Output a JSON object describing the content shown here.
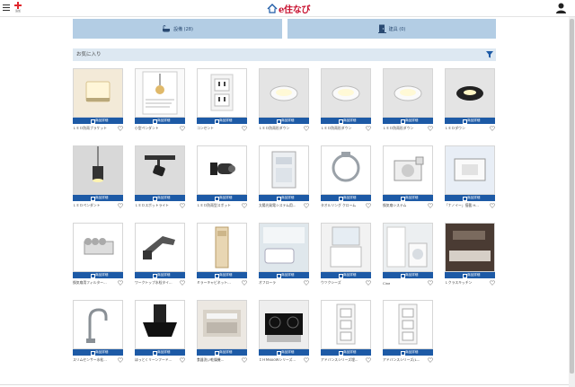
{
  "header": {
    "menu_icon": "hamburger-icon",
    "plus_label": "追加",
    "logo_text": "e住なび",
    "logo_icon": "house-icon",
    "user_icon": "user-icon"
  },
  "tabs": [
    {
      "label": "設備 (28)",
      "icon": "bath-icon"
    },
    {
      "label": "建具 (0)",
      "icon": "door-icon"
    }
  ],
  "favorites": {
    "title": "お気に入り",
    "filter_icon": "filter-icon"
  },
  "badge_label": "商品詳細",
  "colors": {
    "accent": "#1d5aa6",
    "tab_bg": "#b3cde4",
    "bar_bg": "#dde8f2",
    "brand": "#c8102e"
  },
  "products": [
    {
      "name": "ＬＥＤ防雨ブラケット",
      "image": "wall-bracket-light"
    },
    {
      "name": "小型ペンダント",
      "image": "pendant-catalog"
    },
    {
      "name": "コンセント",
      "image": "wall-outlet"
    },
    {
      "name": "ＬＥＤ防雨形ダウン",
      "image": "downlight"
    },
    {
      "name": "ＬＥＤ防雨形ダウン",
      "image": "downlight"
    },
    {
      "name": "ＬＥＤ防雨形ダウン",
      "image": "downlight"
    },
    {
      "name": "ＬＥＤダウン",
      "image": "downlight-black"
    },
    {
      "name": "ＬＥＤペンダント",
      "image": "pendant-light"
    },
    {
      "name": "ＬＥＤスポットライト",
      "image": "spotlight"
    },
    {
      "name": "ＬＥＤ防雨型スポット",
      "image": "outdoor-spot"
    },
    {
      "name": "太陽光発電システム用...",
      "image": "power-conditioner"
    },
    {
      "name": "タオルリング クローム",
      "image": "towel-ring"
    },
    {
      "name": "換気扇システム",
      "image": "ventilation-fan"
    },
    {
      "name": "「ナノイー」搭載 H...",
      "image": "ceiling-ac"
    },
    {
      "name": "換気扇用フィルター...",
      "image": "vent-filter"
    },
    {
      "name": "ワークトップ水栓タイ...",
      "image": "kitchen-faucet"
    },
    {
      "name": "ミラーキャビネット...",
      "image": "tall-cabinet"
    },
    {
      "name": "オフローラ",
      "image": "bathroom"
    },
    {
      "name": "ウツクシーズ",
      "image": "vanity"
    },
    {
      "name": "Cine",
      "image": "laundry-room"
    },
    {
      "name": "Ｌクラスキッチン",
      "image": "kitchen"
    },
    {
      "name": "スリムセンサー水栓...",
      "image": "sensor-faucet"
    },
    {
      "name": "ほっとくリーンフード...",
      "image": "range-hood"
    },
    {
      "name": "食器洗い乾燥機...",
      "image": "dishwasher"
    },
    {
      "name": "ＩＨＭ600Ｗシリーズ...",
      "image": "ih-cooktop"
    },
    {
      "name": "アドバンスシリーズ埋...",
      "image": "wall-switch"
    },
    {
      "name": "アドバンスシリーズ(L...",
      "image": "wall-switch"
    }
  ]
}
